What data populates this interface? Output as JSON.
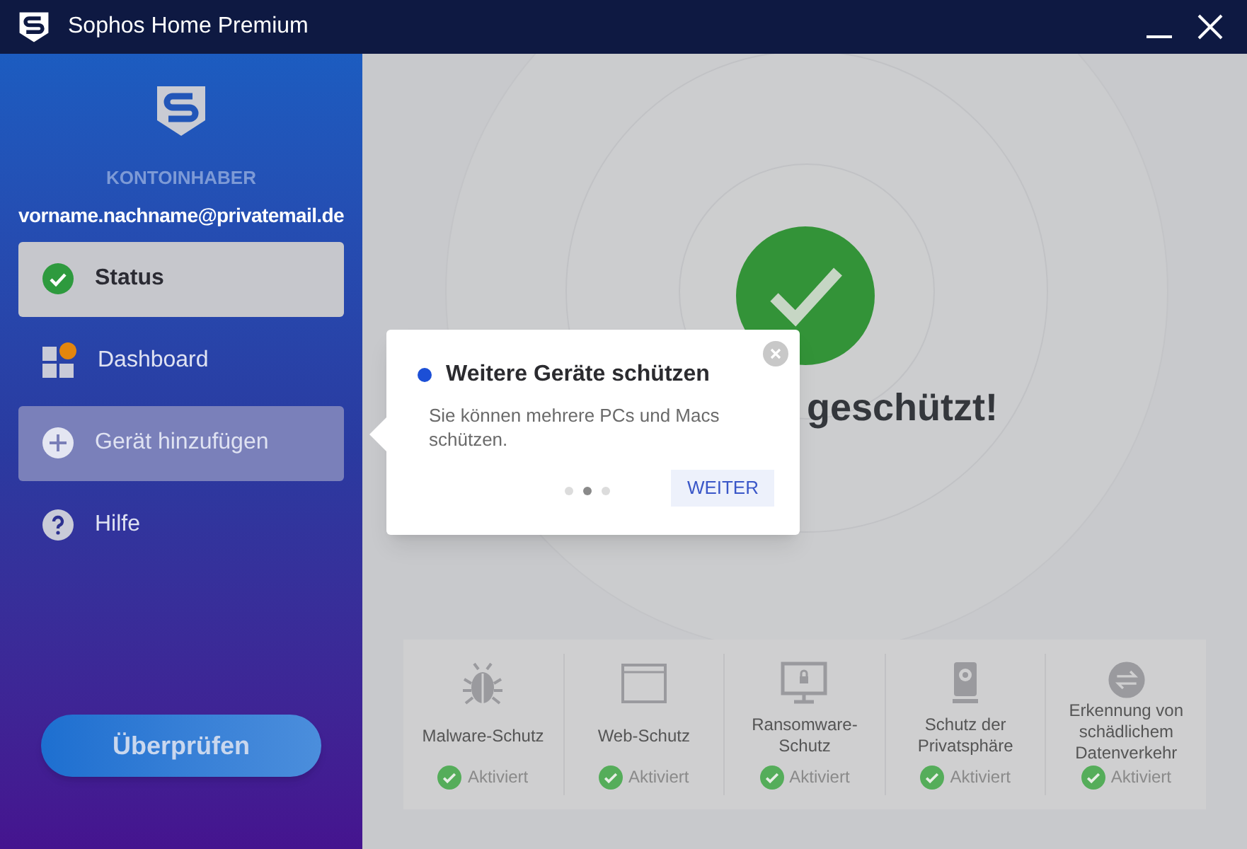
{
  "window": {
    "title": "Sophos Home Premium"
  },
  "sidebar": {
    "account_label": "KONTOINHABER",
    "email": "vorname.nachname@privatemail.de",
    "items": [
      {
        "label": "Status",
        "kind": "check",
        "selected": true,
        "highlighted": false
      },
      {
        "label": "Dashboard",
        "kind": "dashboard",
        "selected": false,
        "highlighted": false
      },
      {
        "label": "Gerät hinzufügen",
        "kind": "plus",
        "selected": false,
        "highlighted": true
      },
      {
        "label": "Hilfe",
        "kind": "help",
        "selected": false,
        "highlighted": false
      }
    ],
    "scan_button": "Überprüfen"
  },
  "status": {
    "heading": "geschützt!"
  },
  "popup": {
    "title": "Weitere Geräte schützen",
    "body": "Sie können mehrere PCs und Macs schützen.",
    "dots": [
      {
        "selected": false
      },
      {
        "selected": true
      },
      {
        "selected": false
      }
    ],
    "button": "WEITER"
  },
  "features": [
    {
      "kind": "bug",
      "label": "Malware-Schutz",
      "status": "Aktiviert"
    },
    {
      "kind": "browser",
      "label": "Web-Schutz",
      "status": "Aktiviert"
    },
    {
      "kind": "monitor",
      "label": "Ransomware-Schutz",
      "status": "Aktiviert"
    },
    {
      "kind": "camera",
      "label": "Schutz der Privatsphäre",
      "status": "Aktiviert"
    },
    {
      "kind": "traffic",
      "label": "Erkennung von schädlichem Datenverkehr",
      "status": "Aktiviert"
    }
  ]
}
